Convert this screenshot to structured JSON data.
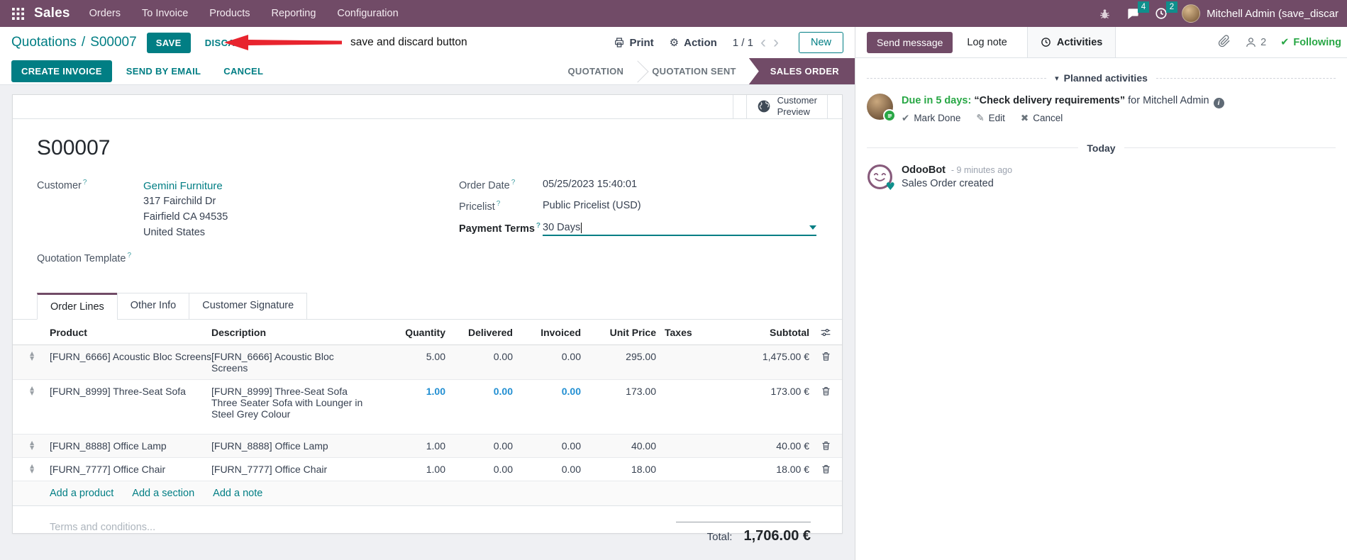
{
  "colors": {
    "brand_purple": "#714B67",
    "accent_teal": "#017E84",
    "badge_teal": "#0f8f8c",
    "success_green": "#28a745",
    "modified_blue": "#228fd2",
    "arrow_red": "#e8242e"
  },
  "icons": {
    "gear": "⚙",
    "check": "✔",
    "pencil": "✎",
    "cross": "✖",
    "triangle_up": "▲",
    "triangle_down": "▼",
    "caret_small": "▾",
    "heart": "♥",
    "chevron_left": "‹",
    "chevron_right": "›",
    "info": "i"
  },
  "navbar": {
    "brand": "Sales",
    "menus": [
      "Orders",
      "To Invoice",
      "Products",
      "Reporting",
      "Configuration"
    ],
    "message_badge": "4",
    "activity_badge": "2",
    "user_name": "Mitchell Admin (save_discar"
  },
  "control": {
    "breadcrumb_parent": "Quotations",
    "breadcrumb_sep": "/",
    "breadcrumb_current": "S00007",
    "save": "SAVE",
    "discard": "DISCARD",
    "annotation": "save and discard button",
    "print": "Print",
    "action": "Action",
    "pager": "1 / 1",
    "new": "New"
  },
  "statusbar": {
    "actions": [
      "CREATE INVOICE",
      "SEND BY EMAIL",
      "CANCEL"
    ],
    "states": [
      "QUOTATION",
      "QUOTATION SENT",
      "SALES ORDER"
    ],
    "active_state": "SALES ORDER"
  },
  "form": {
    "customer_preview_line1": "Customer",
    "customer_preview_line2": "Preview",
    "record_name": "S00007",
    "help_marker": "?",
    "customer_label": "Customer",
    "customer_name": "Gemini Furniture",
    "address_line1": "317 Fairchild Dr",
    "address_line2": "Fairfield CA 94535",
    "address_line3": "United States",
    "quotation_template_label": "Quotation Template",
    "order_date_label": "Order Date",
    "order_date_value": "05/25/2023 15:40:01",
    "pricelist_label": "Pricelist",
    "pricelist_value": "Public Pricelist (USD)",
    "payment_terms_label": "Payment Terms",
    "payment_terms_value": "30 Days",
    "tabs": [
      "Order Lines",
      "Other Info",
      "Customer Signature"
    ],
    "active_tab": "Order Lines"
  },
  "order_lines": {
    "headers": {
      "product": "Product",
      "description": "Description",
      "quantity": "Quantity",
      "delivered": "Delivered",
      "invoiced": "Invoiced",
      "unit_price": "Unit Price",
      "taxes": "Taxes",
      "subtotal": "Subtotal"
    },
    "rows": [
      {
        "product": "[FURN_6666] Acoustic Bloc Screens",
        "description": "[FURN_6666] Acoustic Bloc Screens",
        "description_extra": "",
        "quantity": "5.00",
        "delivered": "0.00",
        "invoiced": "0.00",
        "unit_price": "295.00",
        "taxes": "",
        "subtotal": "1,475.00 €"
      },
      {
        "product": "[FURN_8999] Three-Seat Sofa",
        "description": "[FURN_8999] Three-Seat Sofa",
        "description_extra": "Three Seater Sofa with Lounger in Steel Grey Colour",
        "quantity": "1.00",
        "delivered": "0.00",
        "invoiced": "0.00",
        "unit_price": "173.00",
        "taxes": "",
        "subtotal": "173.00 €"
      },
      {
        "product": "[FURN_8888] Office Lamp",
        "description": "[FURN_8888] Office Lamp",
        "description_extra": "",
        "quantity": "1.00",
        "delivered": "0.00",
        "invoiced": "0.00",
        "unit_price": "40.00",
        "taxes": "",
        "subtotal": "40.00 €"
      },
      {
        "product": "[FURN_7777] Office Chair",
        "description": "[FURN_7777] Office Chair",
        "description_extra": "",
        "quantity": "1.00",
        "delivered": "0.00",
        "invoiced": "0.00",
        "unit_price": "18.00",
        "taxes": "",
        "subtotal": "18.00 €"
      }
    ],
    "add_product": "Add a product",
    "add_section": "Add a section",
    "add_note": "Add a note",
    "terms_placeholder": "Terms and conditions...",
    "total_label": "Total:",
    "total_value": "1,706.00 €"
  },
  "chatter": {
    "send_message": "Send message",
    "log_note": "Log note",
    "activities": "Activities",
    "followers_count": "2",
    "following": "Following",
    "planned_title": "Planned activities",
    "activity_due": "Due in 5 days:",
    "activity_summary": "“Check delivery requirements”",
    "activity_for": "for Mitchell Admin",
    "mark_done": "Mark Done",
    "edit": "Edit",
    "cancel": "Cancel",
    "today": "Today",
    "author": "OdooBot",
    "time_ago": "- 9 minutes ago",
    "body": "Sales Order created"
  }
}
